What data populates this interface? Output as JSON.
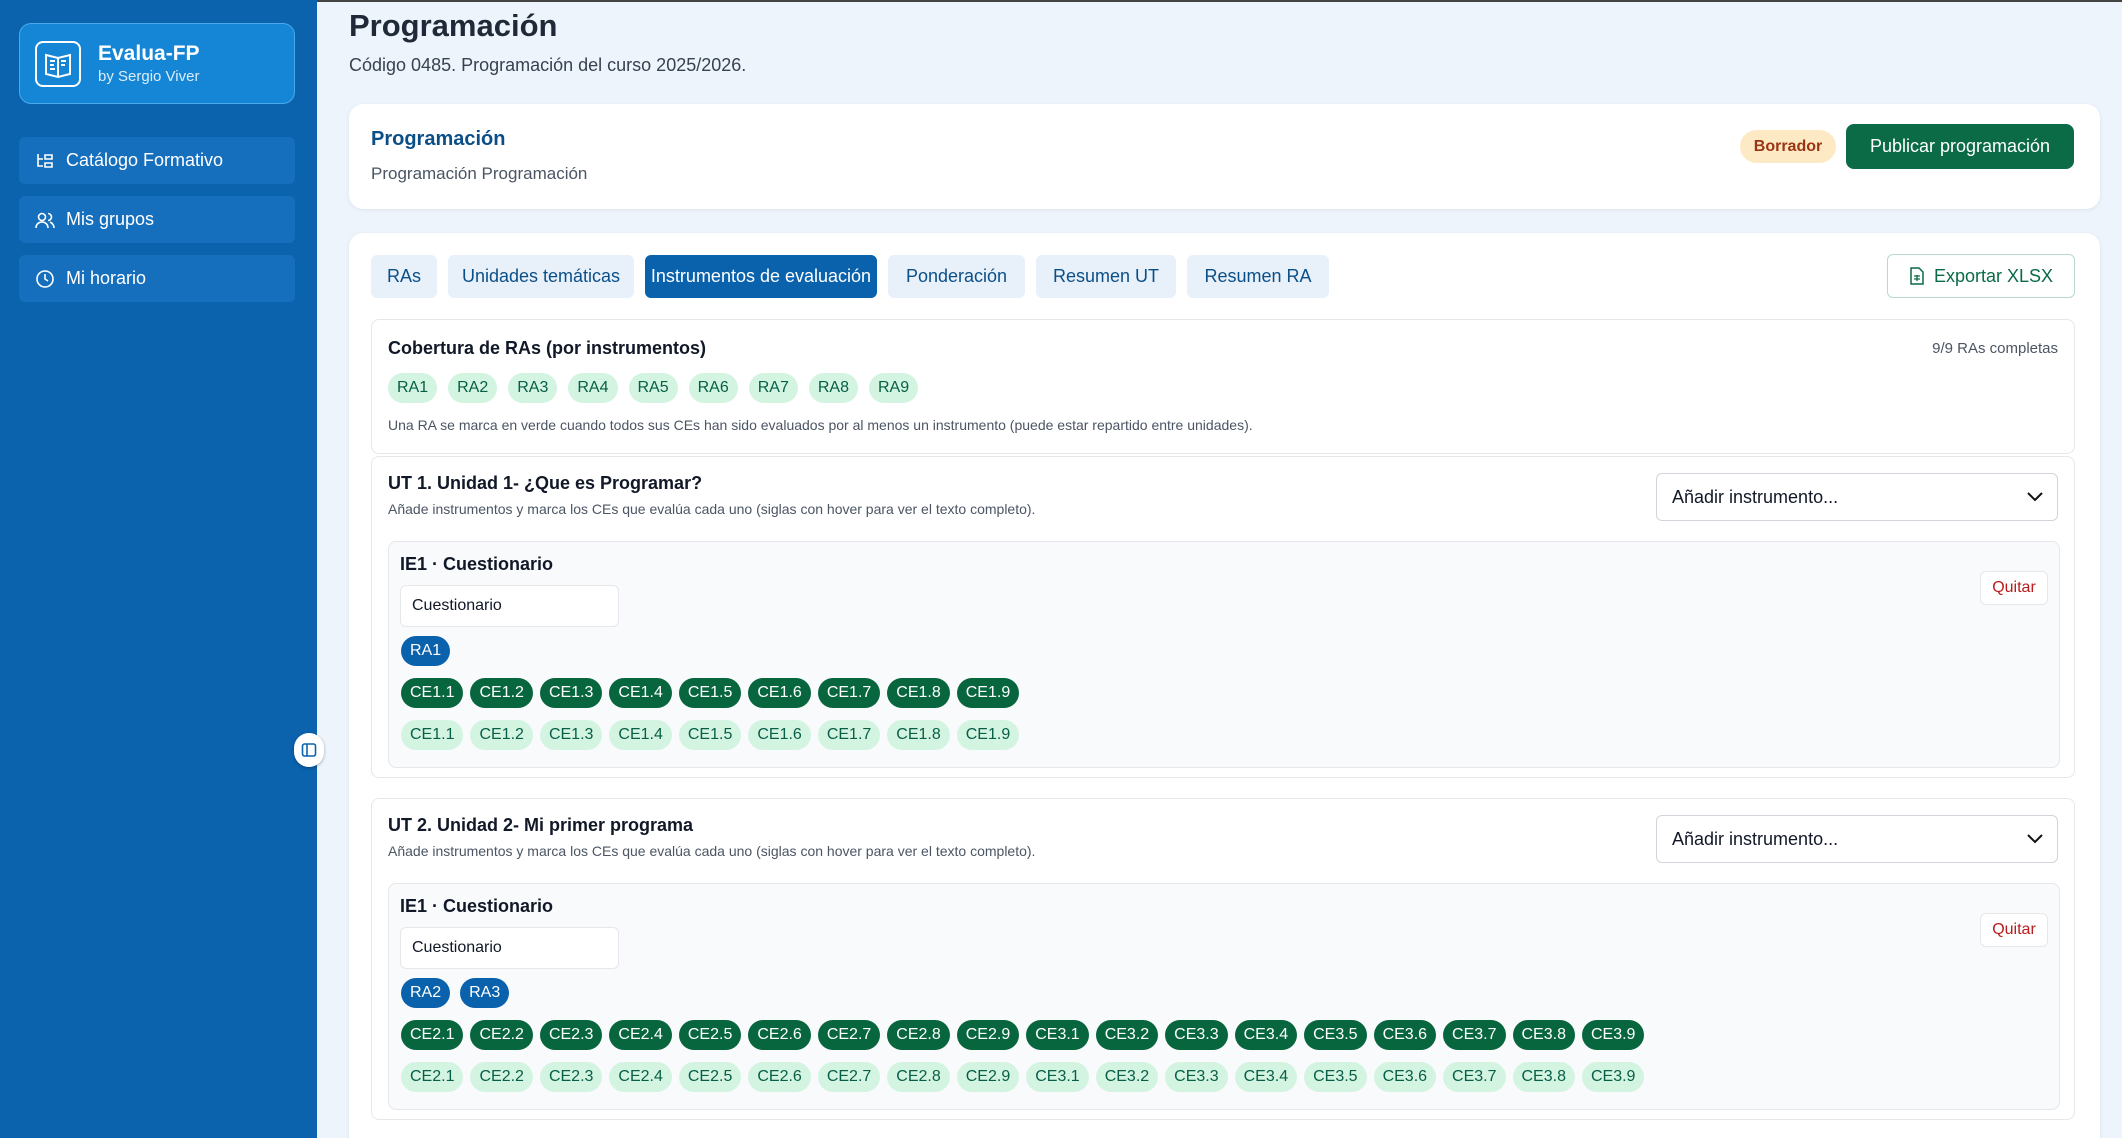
{
  "app": {
    "title": "Evalua-FP",
    "subtitle": "by Sergio Viver"
  },
  "nav": [
    {
      "label": "Catálogo Formativo",
      "icon": "catalog-icon"
    },
    {
      "label": "Mis grupos",
      "icon": "users-icon"
    },
    {
      "label": "Mi horario",
      "icon": "clock-icon"
    }
  ],
  "page": {
    "title": "Programación",
    "subtitle": "Código 0485. Programación del curso 2025/2026."
  },
  "header_card": {
    "title": "Programación",
    "subtitle": "Programación Programación",
    "status": "Borrador",
    "publish_label": "Publicar programación"
  },
  "tabs": [
    "RAs",
    "Unidades temáticas",
    "Instrumentos de evaluación",
    "Ponderación",
    "Resumen UT",
    "Resumen RA"
  ],
  "active_tab": "Instrumentos de evaluación",
  "export_label": "Exportar XLSX",
  "coverage": {
    "title": "Cobertura de RAs (por instrumentos)",
    "complete": "9/9 RAs completas",
    "ras": [
      "RA1",
      "RA2",
      "RA3",
      "RA4",
      "RA5",
      "RA6",
      "RA7",
      "RA8",
      "RA9"
    ],
    "note": "Una RA se marca en verde cuando todos sus CEs han sido evaluados por al menos un instrumento (puede estar repartido entre unidades)."
  },
  "units": [
    {
      "title": "UT 1. Unidad 1- ¿Que es Programar?",
      "note": "Añade instrumentos y marca los CEs que evalúa cada uno (siglas con hover para ver el texto completo).",
      "select_label": "Añadir instrumento...",
      "instrument": {
        "title": "IE1 · Cuestionario",
        "name_value": "Cuestionario",
        "remove_label": "Quitar",
        "ras": [
          "RA1"
        ],
        "ces_selected": [
          "CE1.1",
          "CE1.2",
          "CE1.3",
          "CE1.4",
          "CE1.5",
          "CE1.6",
          "CE1.7",
          "CE1.8",
          "CE1.9"
        ],
        "ces_available": [
          "CE1.1",
          "CE1.2",
          "CE1.3",
          "CE1.4",
          "CE1.5",
          "CE1.6",
          "CE1.7",
          "CE1.8",
          "CE1.9"
        ]
      }
    },
    {
      "title": "UT 2. Unidad 2- Mi primer programa",
      "note": "Añade instrumentos y marca los CEs que evalúa cada uno (siglas con hover para ver el texto completo).",
      "select_label": "Añadir instrumento...",
      "instrument": {
        "title": "IE1 · Cuestionario",
        "name_value": "Cuestionario",
        "remove_label": "Quitar",
        "ras": [
          "RA2",
          "RA3"
        ],
        "ces_selected": [
          "CE2.1",
          "CE2.2",
          "CE2.3",
          "CE2.4",
          "CE2.5",
          "CE2.6",
          "CE2.7",
          "CE2.8",
          "CE2.9",
          "CE3.1",
          "CE3.2",
          "CE3.3",
          "CE3.4",
          "CE3.5",
          "CE3.6",
          "CE3.7",
          "CE3.8",
          "CE3.9"
        ],
        "ces_available": [
          "CE2.1",
          "CE2.2",
          "CE2.3",
          "CE2.4",
          "CE2.5",
          "CE2.6",
          "CE2.7",
          "CE2.8",
          "CE2.9",
          "CE3.1",
          "CE3.2",
          "CE3.3",
          "CE3.4",
          "CE3.5",
          "CE3.6",
          "CE3.7",
          "CE3.8",
          "CE3.9"
        ]
      }
    }
  ],
  "colors": {
    "sidebar": "#0b62ad",
    "primary": "#0a62ad",
    "success": "#08663f",
    "success_light": "#d4f4e2",
    "warning_bg": "#fde9c4"
  }
}
